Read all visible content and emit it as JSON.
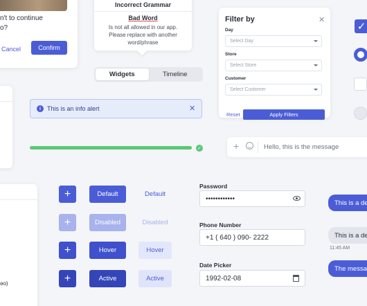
{
  "confirm_dialog": {
    "message": "n't to continue\no?",
    "cancel_label": "Cancel",
    "confirm_label": "Confirm"
  },
  "grammar_tooltip": {
    "title": "Incorrect Grammar",
    "word": "Bad Word",
    "description": "Is not all allowed in our app. Please replace with another word/phrase"
  },
  "tabs": [
    {
      "label": "Widgets",
      "active": true
    },
    {
      "label": "Timeline",
      "active": false
    }
  ],
  "filter": {
    "title": "Filter by",
    "fields": [
      {
        "label": "Day",
        "placeholder": "Select Day"
      },
      {
        "label": "Store",
        "placeholder": "Select Store"
      },
      {
        "label": "Customer",
        "placeholder": "Select Customer"
      }
    ],
    "reset_label": "Reset",
    "apply_label": "Apply Filters"
  },
  "controls": {
    "checkbox_checked": true,
    "radio_selected": true,
    "checkbox_unchecked": false,
    "radio_disabled": false
  },
  "alert": {
    "icon": "info-icon",
    "text": "This is an info alert"
  },
  "progress": {
    "value_percent": 100,
    "color": "#5bc878"
  },
  "chat_input": {
    "text": "Hello, this is the message"
  },
  "left_list": {
    "partial_text": "əo)"
  },
  "buttons": {
    "rows": [
      {
        "state": "default",
        "label": "Default",
        "link_label": "Default"
      },
      {
        "state": "disabled",
        "label": "Disabled",
        "link_label": "Disabled"
      },
      {
        "state": "hover",
        "label": "Hover",
        "link_label": "Hover"
      },
      {
        "state": "active",
        "label": "Active",
        "link_label": "Active"
      }
    ]
  },
  "form": {
    "password_label": "Password",
    "password_value": "••••••••••••",
    "phone_label": "Phone Number",
    "phone_value": "+1 ( 640 ) 090- 2222",
    "date_label": "Date Picker",
    "date_value": "1992-02-08"
  },
  "chat": {
    "messages": [
      {
        "from": "me",
        "text": "This is a defa"
      },
      {
        "from": "them",
        "text": "This is a defa"
      },
      {
        "from": "me",
        "text": "The message"
      }
    ],
    "timestamp": "11:45 AM"
  },
  "colors": {
    "accent": "#4b5dd6",
    "success": "#5bc878",
    "background": "#f4f5f8"
  }
}
